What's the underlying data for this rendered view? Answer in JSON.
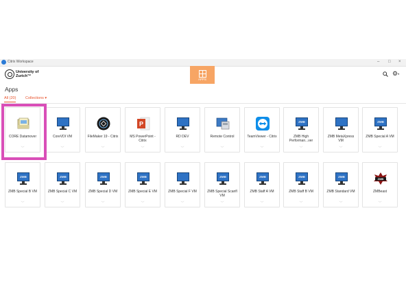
{
  "window": {
    "title": "Citrix Workspace",
    "controls": [
      "–",
      "□",
      "×"
    ]
  },
  "brand": {
    "line1": "University of",
    "line2": "Zurich™"
  },
  "nav": {
    "apps_label": "APPS"
  },
  "page": {
    "title": "Apps"
  },
  "tabs": {
    "all": "All (20)",
    "collections": "Collections ▾"
  },
  "icons": {
    "search": "search-icon",
    "settings": "gear-icon"
  },
  "colors": {
    "accent": "#f7a564",
    "tab_active": "#e8542e",
    "highlight": "#d94fb8"
  },
  "apps": [
    {
      "label": "CORE Datamover",
      "icon": "folder-transfer-icon"
    },
    {
      "label": "CoreVDI VM",
      "icon": "monitor-icon"
    },
    {
      "label": "FileMaker 19 - Citrix",
      "icon": "filemaker-icon"
    },
    {
      "label": "MS PowerPoint - Citrix",
      "icon": "powerpoint-icon"
    },
    {
      "label": "RD DEV",
      "icon": "monitor-icon"
    },
    {
      "label": "Remote Control",
      "icon": "remote-control-icon"
    },
    {
      "label": "TeamViewer - Citrix",
      "icon": "teamviewer-icon"
    },
    {
      "label": "ZMB High Performan...ver",
      "icon": "zmb-monitor-icon"
    },
    {
      "label": "ZMB MetaXpress VM",
      "icon": "monitor-icon"
    },
    {
      "label": "ZMB Special A VM",
      "icon": "zmb-monitor-icon"
    },
    {
      "label": "ZMB Special B VM",
      "icon": "zmb-monitor-icon"
    },
    {
      "label": "ZMB Special C VM",
      "icon": "zmb-monitor-icon"
    },
    {
      "label": "ZMB Special D VM",
      "icon": "zmb-monitor-icon"
    },
    {
      "label": "ZMB Special E VM",
      "icon": "zmb-monitor-icon"
    },
    {
      "label": "ZMB Special F VM",
      "icon": "monitor-icon"
    },
    {
      "label": "ZMB Special Scanfl VM",
      "icon": "zmb-monitor-icon"
    },
    {
      "label": "ZMB Staff A VM",
      "icon": "zmb-monitor-icon"
    },
    {
      "label": "ZMB Staff B VM",
      "icon": "zmb-monitor-icon"
    },
    {
      "label": "ZMB Standard VM",
      "icon": "zmb-monitor-icon"
    },
    {
      "label": "ZMBeast",
      "icon": "zmbeast-icon"
    }
  ]
}
